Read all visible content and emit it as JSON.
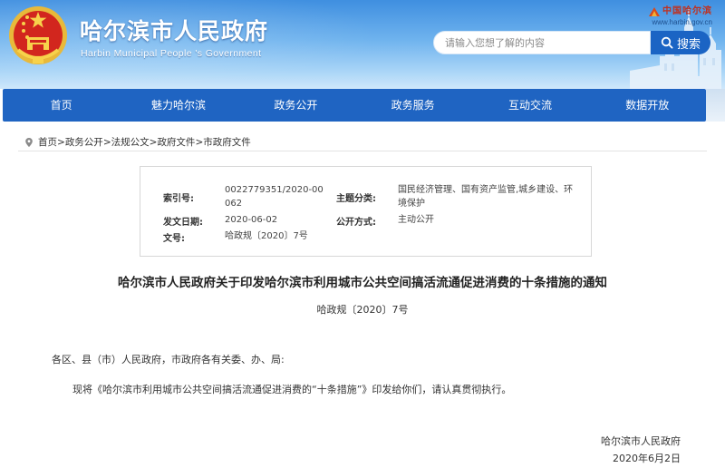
{
  "header": {
    "site_name": "哈尔滨市人民政府",
    "site_name_en": "Harbin Municipal People 's Government",
    "portal_brand": "中国哈尔滨",
    "portal_url": "www.harbin.gov.cn",
    "emblem_icon": "national-emblem-icon"
  },
  "search": {
    "placeholder": "请输入您想了解的内容",
    "button_label": "搜索",
    "icon": "search-icon"
  },
  "nav": {
    "items": [
      "首页",
      "魅力哈尔滨",
      "政务公开",
      "政务服务",
      "互动交流",
      "数据开放"
    ]
  },
  "breadcrumb": {
    "icon": "location-pin-icon",
    "items": [
      "首页",
      "政务公开",
      "法规公文",
      "政府文件",
      "市政府文件"
    ],
    "separator": ">"
  },
  "meta": {
    "index_label": "索引号:",
    "index_value": "0022779351/2020-00062",
    "topic_label": "主题分类:",
    "topic_value": "国民经济管理、国有资产监管,城乡建设、环境保护",
    "issue_date_label": "发文日期:",
    "issue_date_value": "2020-06-02",
    "disclosure_label": "公开方式:",
    "disclosure_value": "主动公开",
    "doc_no_label": "文号:",
    "doc_no_value": "哈政规〔2020〕7号"
  },
  "document": {
    "title": "哈尔滨市人民政府关于印发哈尔滨市利用城市公共空间搞活流通促进消费的十条措施的通知",
    "number": "哈政规〔2020〕7号",
    "salutation": "各区、县（市）人民政府，市政府各有关委、办、局:",
    "body": "现将《哈尔滨市利用城市公共空间搞活流通促进消费的“十条措施”》印发给你们，请认真贯彻执行。",
    "signer": "哈尔滨市人民政府",
    "date": "2020年6月2日"
  },
  "colors": {
    "nav_bg": "#1f64c2",
    "search_button": "#1b64c4",
    "header_top": "#3f8fe0",
    "brand_red": "#c0301e"
  }
}
